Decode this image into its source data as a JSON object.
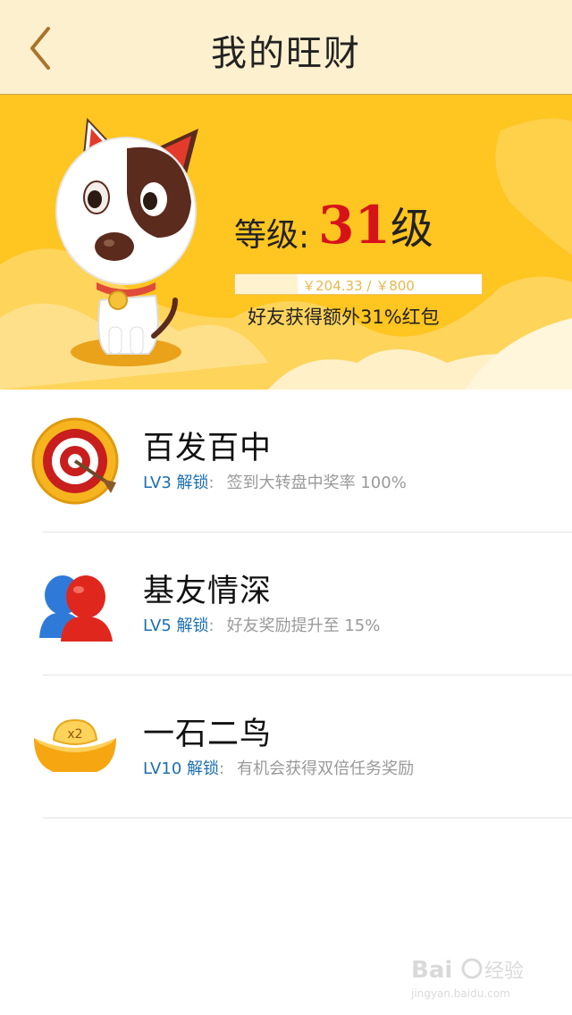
{
  "header": {
    "title": "我的旺财"
  },
  "level": {
    "label": "等级",
    "colon": ":",
    "value": "31",
    "suffix": "级",
    "progress_text": "￥204.33 / ￥800",
    "progress_fraction": 0.255,
    "bonus_text": "好友获得额外31%红包"
  },
  "perks": [
    {
      "title": "百发百中",
      "level": "LV3 解锁",
      "colon": ":",
      "desc": "签到大转盘中奖率 100%",
      "icon": "target-icon"
    },
    {
      "title": "基友情深",
      "level": "LV5 解锁",
      "colon": ":",
      "desc": "好友奖励提升至 15%",
      "icon": "friends-icon"
    },
    {
      "title": "一石二鸟",
      "level": "LV10 解锁",
      "colon": ":",
      "desc": "有机会获得双倍任务奖励",
      "icon": "gold-ingot-icon",
      "badge": "x2"
    }
  ],
  "watermark": {
    "logo": "Bai du 经验",
    "url": "jingyan.baidu.com"
  },
  "colors": {
    "accent": "#ffc91e",
    "header_bg": "#fdf0cf",
    "level_red": "#d6131b",
    "lv_blue": "#1b6fb2"
  }
}
